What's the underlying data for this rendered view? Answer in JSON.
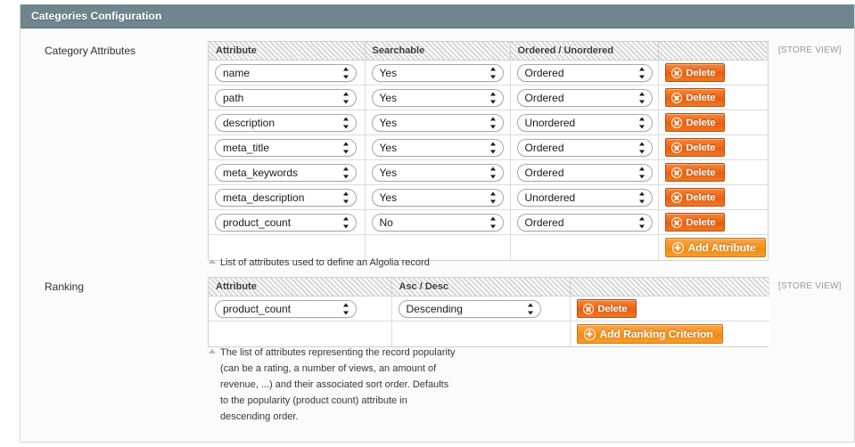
{
  "panel": {
    "title": "Categories Configuration"
  },
  "fields": {
    "category_attributes": {
      "label": "Category Attributes",
      "scope": "[STORE VIEW]",
      "columns": [
        "Attribute",
        "Searchable",
        "Ordered / Unordered",
        ""
      ],
      "rows": [
        {
          "attribute": "name",
          "searchable": "Yes",
          "ordered": "Ordered",
          "delete_label": "Delete"
        },
        {
          "attribute": "path",
          "searchable": "Yes",
          "ordered": "Ordered",
          "delete_label": "Delete"
        },
        {
          "attribute": "description",
          "searchable": "Yes",
          "ordered": "Unordered",
          "delete_label": "Delete"
        },
        {
          "attribute": "meta_title",
          "searchable": "Yes",
          "ordered": "Ordered",
          "delete_label": "Delete"
        },
        {
          "attribute": "meta_keywords",
          "searchable": "Yes",
          "ordered": "Ordered",
          "delete_label": "Delete"
        },
        {
          "attribute": "meta_description",
          "searchable": "Yes",
          "ordered": "Unordered",
          "delete_label": "Delete"
        },
        {
          "attribute": "product_count",
          "searchable": "No",
          "ordered": "Ordered",
          "delete_label": "Delete"
        }
      ],
      "add_label": "Add Attribute",
      "hint": "List of attributes used to define an Algolia record"
    },
    "ranking": {
      "label": "Ranking",
      "scope": "[STORE VIEW]",
      "columns": [
        "Attribute",
        "Asc / Desc",
        ""
      ],
      "rows": [
        {
          "attribute": "product_count",
          "direction": "Descending",
          "delete_label": "Delete"
        }
      ],
      "add_label": "Add Ranking Criterion",
      "hint": "The list of attributes representing the record popularity\n(can be a rating, a number of views, an amount of\nrevenue, ...) and their associated sort order. Defaults\nto the popularity (product count) attribute in\ndescending order."
    }
  },
  "icons": {
    "delete": "circle-x-icon",
    "add": "circle-plus-icon",
    "hint": "triangle-up-icon",
    "select": "up-down-arrows-icon"
  },
  "colors": {
    "panel_header": "#6f868f",
    "button_delete": "#ef6716",
    "button_add": "#f7931e",
    "scope_note": "#8d9aa8"
  }
}
